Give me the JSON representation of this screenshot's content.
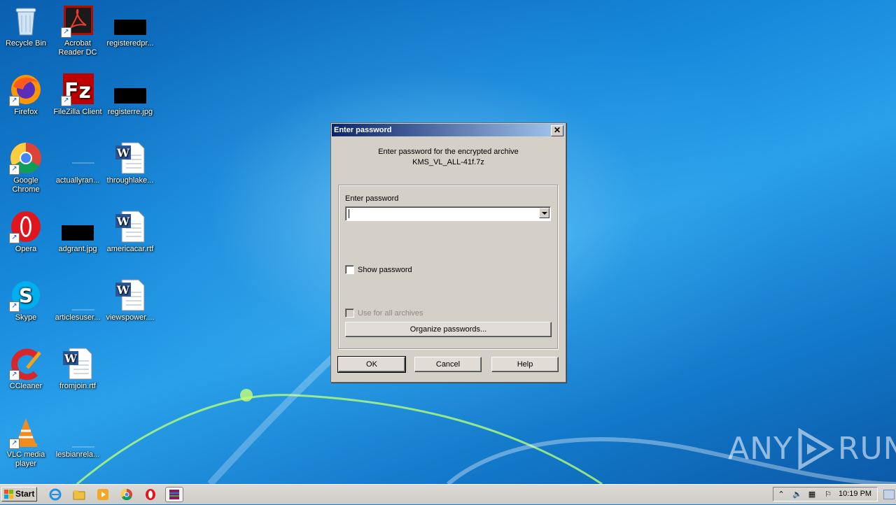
{
  "desktop": {
    "icons": [
      {
        "label": "Recycle Bin",
        "icon": "recycle-bin-icon"
      },
      {
        "label": "Acrobat Reader DC",
        "line1": "Acrobat",
        "line2": "Reader DC",
        "icon": "acrobat-icon"
      },
      {
        "label": "registeredpr...",
        "icon": "image-thumbnail-icon"
      },
      {
        "label": "Firefox",
        "icon": "firefox-icon"
      },
      {
        "label": "FileZilla Client",
        "icon": "filezilla-icon"
      },
      {
        "label": "registerre.jpg",
        "icon": "image-thumbnail-icon"
      },
      {
        "label": "Google Chrome",
        "line1": "Google",
        "line2": "Chrome",
        "icon": "chrome-icon"
      },
      {
        "label": "actuallyran...",
        "icon": "blank-file-icon"
      },
      {
        "label": "throughlake...",
        "icon": "word-document-icon"
      },
      {
        "label": "Opera",
        "icon": "opera-icon"
      },
      {
        "label": "adgrant.jpg",
        "icon": "image-thumbnail-icon"
      },
      {
        "label": "americacar.rtf",
        "icon": "word-document-icon"
      },
      {
        "label": "Skype",
        "icon": "skype-icon"
      },
      {
        "label": "articlesuser...",
        "icon": "blank-file-icon"
      },
      {
        "label": "viewspower....",
        "icon": "word-document-icon"
      },
      {
        "label": "CCleaner",
        "icon": "ccleaner-icon"
      },
      {
        "label": "fromjoin.rtf",
        "icon": "word-document-icon"
      },
      {
        "label": "VLC media player",
        "line1": "VLC media",
        "line2": "player",
        "icon": "vlc-icon"
      },
      {
        "label": "lesbianrela...",
        "icon": "blank-file-icon"
      }
    ]
  },
  "dialog": {
    "title": "Enter password",
    "close_label": "✕",
    "message_line1": "Enter password for the encrypted archive",
    "message_line2": "KMS_VL_ALL-41f.7z",
    "password_label": "Enter password",
    "password_value": "",
    "show_password_label": "Show password",
    "show_password_checked": false,
    "use_all_label": "Use for all archives",
    "use_all_checked": false,
    "organize_label": "Organize passwords...",
    "ok_label": "OK",
    "cancel_label": "Cancel",
    "help_label": "Help"
  },
  "watermark": {
    "left": "ANY",
    "right": "RUN"
  },
  "taskbar": {
    "start_label": "Start",
    "clock": "10:19 PM",
    "pinned": [
      "internet-explorer-icon",
      "explorer-folder-icon",
      "media-player-icon",
      "chrome-icon",
      "opera-icon",
      "winrar-icon"
    ]
  },
  "colors": {
    "titlebar_start": "#0a246a",
    "titlebar_end": "#a6caf0",
    "dialog_bg": "#d4d0c8"
  }
}
